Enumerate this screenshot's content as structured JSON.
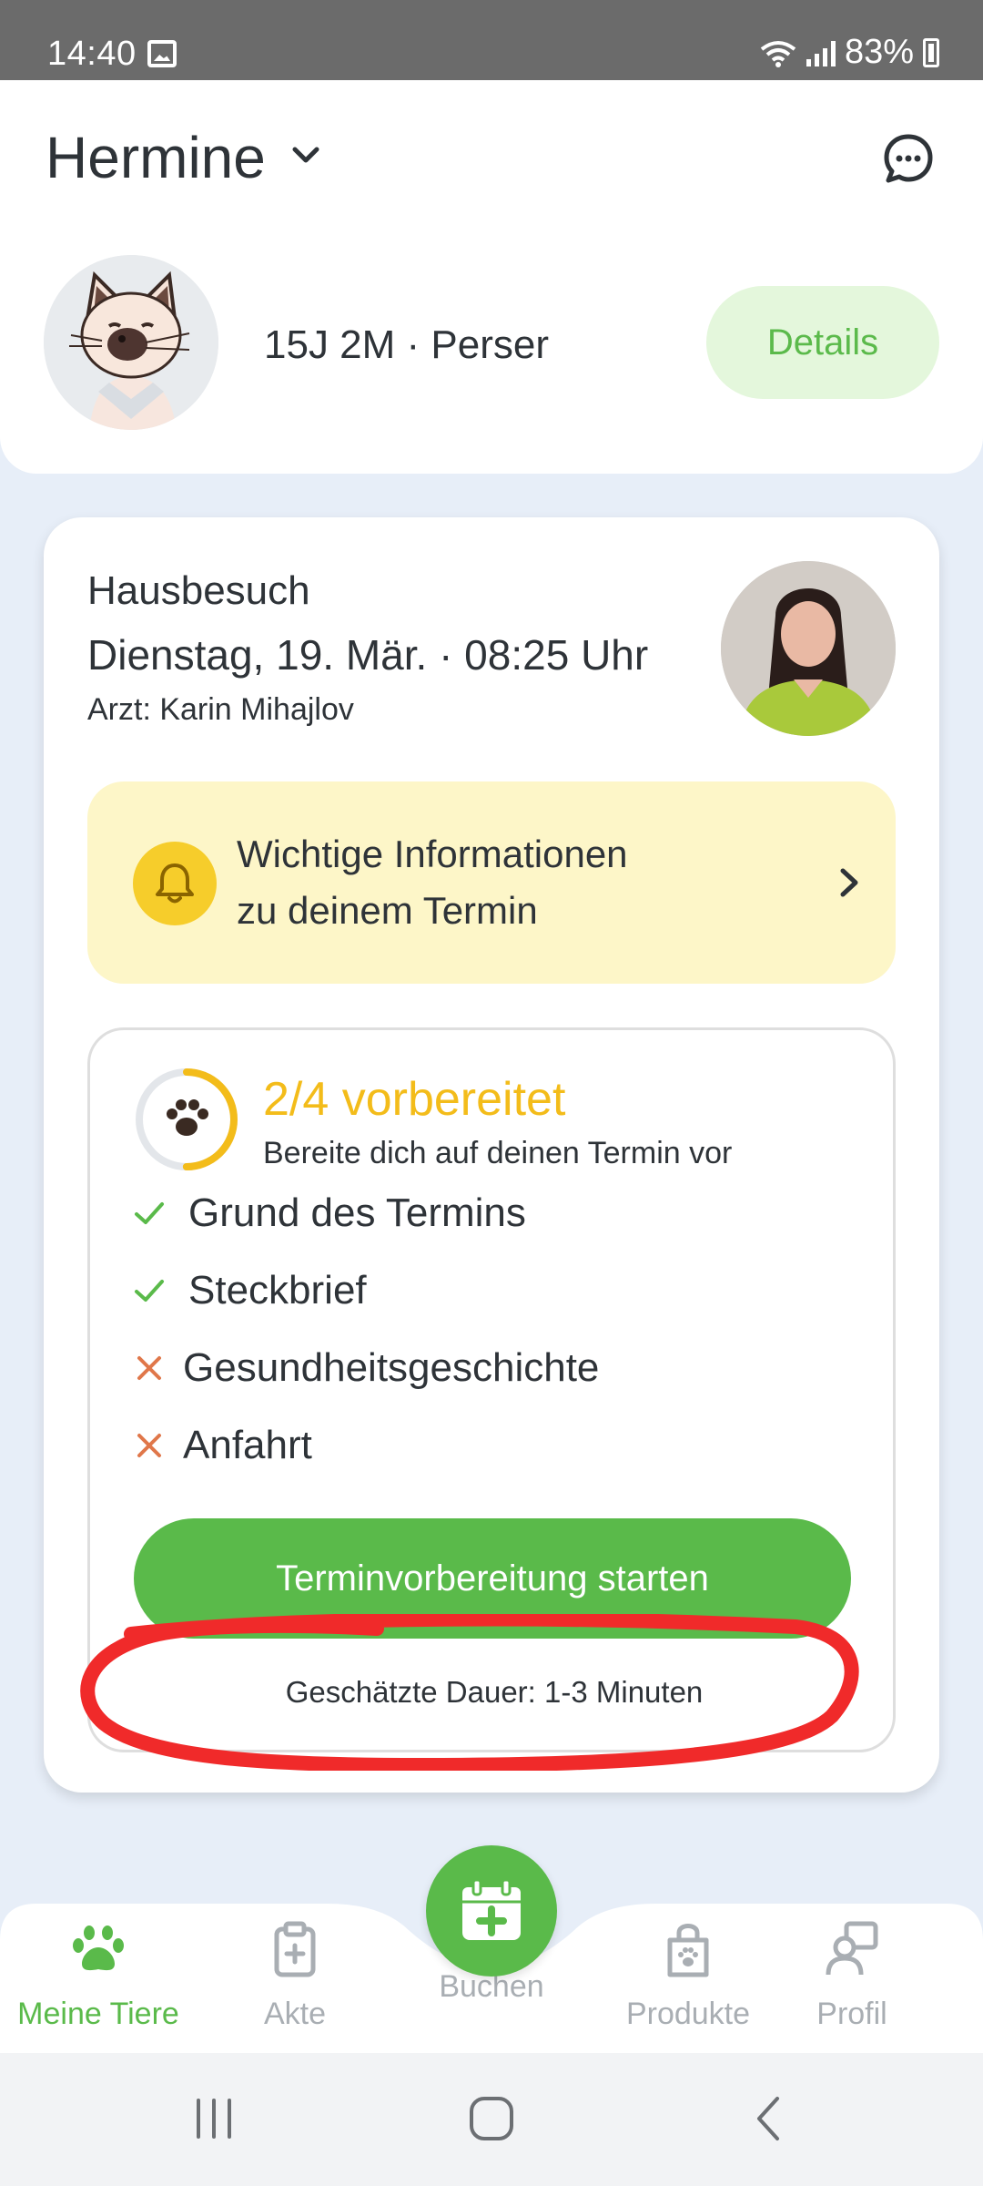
{
  "status_bar": {
    "time": "14:40",
    "battery": "83%"
  },
  "header": {
    "pet_name": "Hermine"
  },
  "pet": {
    "meta": "15J 2M · Perser",
    "details_label": "Details"
  },
  "appointment": {
    "type": "Hausbesuch",
    "date_time": "Dienstag, 19. Mär. · 08:25 Uhr",
    "doctor": "Arzt: Karin Mihajlov",
    "info_line1": "Wichtige Informationen",
    "info_line2": "zu deinem Termin"
  },
  "preparation": {
    "title": "2/4 vorbereitet",
    "progress": 0.5,
    "subtitle": "Bereite dich auf deinen Termin vor",
    "items": [
      {
        "label": "Grund des Termins",
        "done": true
      },
      {
        "label": "Steckbrief",
        "done": true
      },
      {
        "label": "Gesundheitsgeschichte",
        "done": false
      },
      {
        "label": "Anfahrt",
        "done": false
      }
    ],
    "start_label": "Terminvorbereitung starten",
    "duration": "Geschätzte Dauer: 1-3 Minuten"
  },
  "nav": {
    "items": [
      {
        "label": "Meine Tiere",
        "icon": "paw-icon",
        "active": true
      },
      {
        "label": "Akte",
        "icon": "clipboard-icon",
        "active": false
      },
      {
        "label": "Buchen",
        "icon": "calendar-plus-icon",
        "active": false
      },
      {
        "label": "Produkte",
        "icon": "bag-icon",
        "active": false
      },
      {
        "label": "Profil",
        "icon": "profile-icon",
        "active": false
      }
    ]
  },
  "colors": {
    "accent_green": "#5aba4a",
    "highlight_yellow": "#f3bc1a",
    "info_bg": "#fdf6c8",
    "cross_orange": "#e0774a",
    "annotation_red": "#f02a2a"
  }
}
